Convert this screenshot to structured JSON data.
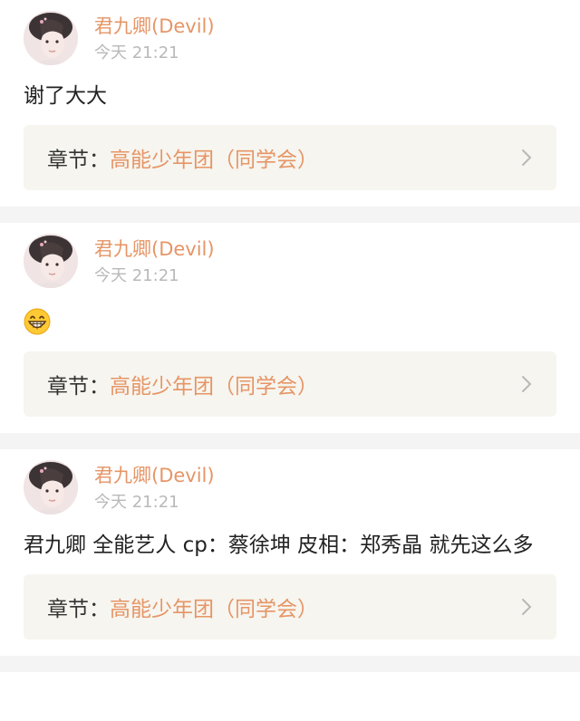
{
  "comments": [
    {
      "username": "君九卿(Devil)",
      "time": "今天 21:21",
      "text": "谢了大大",
      "chapter_prefix": "章节：",
      "chapter_title": "高能少年团（同学会）"
    },
    {
      "username": "君九卿(Devil)",
      "time": "今天 21:21",
      "emoji": "grinning-face-emoji",
      "chapter_prefix": "章节：",
      "chapter_title": "高能少年团（同学会）"
    },
    {
      "username": "君九卿(Devil)",
      "time": "今天 21:21",
      "text": "君九卿 全能艺人 cp：蔡徐坤 皮相：郑秀晶 就先这么多",
      "chapter_prefix": "章节：",
      "chapter_title": "高能少年团（同学会）"
    }
  ],
  "colors": {
    "username": "#e69566",
    "timestamp": "#b9b9b9",
    "chapter_bg": "#f6f5ef",
    "divider": "#f4f4f4"
  }
}
